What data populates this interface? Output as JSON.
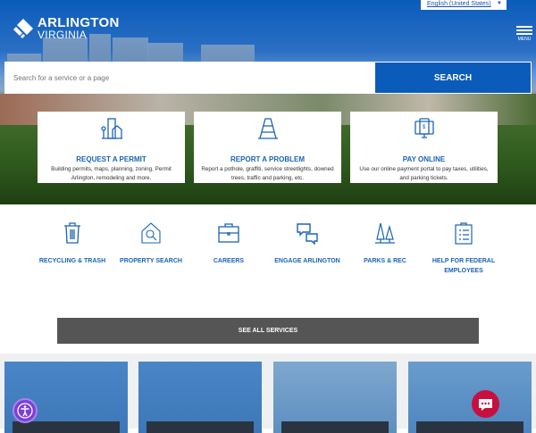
{
  "header": {
    "language": "English (United States)",
    "logo_line1": "ARLINGTON",
    "logo_line2": "VIRGINIA",
    "menu_label": "MENU"
  },
  "search": {
    "placeholder": "Search for a service or a page",
    "button": "SEARCH"
  },
  "feature_cards": [
    {
      "title": "REQUEST A PERMIT",
      "desc": "Building permits, maps, planning, zoning, Permit Arlington, remodeling and more.",
      "icon": "building-icon"
    },
    {
      "title": "REPORT A PROBLEM",
      "desc": "Report a pothole, graffiti, service streetlights, downed trees, traffic and parking, etc.",
      "icon": "traffic-cone-icon"
    },
    {
      "title": "PAY ONLINE",
      "desc": "Use our online payment portal to pay taxes, utilities, and parking tickets.",
      "icon": "payment-device-icon"
    }
  ],
  "quick_links": [
    {
      "label": "RECYCLING & TRASH",
      "icon": "trash-icon"
    },
    {
      "label": "PROPERTY SEARCH",
      "icon": "house-search-icon"
    },
    {
      "label": "CAREERS",
      "icon": "briefcase-icon"
    },
    {
      "label": "ENGAGE ARLINGTON",
      "icon": "chat-bubbles-icon"
    },
    {
      "label": "PARKS & REC",
      "icon": "trees-icon"
    },
    {
      "label": "HELP FOR FEDERAL EMPLOYEES",
      "icon": "clipboard-icon"
    }
  ],
  "see_all": "SEE ALL SERVICES",
  "colors": {
    "brand": "#0b5cba",
    "link": "#1a63b5",
    "accessibility": "#7b3fd6",
    "chat": "#c8103e"
  }
}
